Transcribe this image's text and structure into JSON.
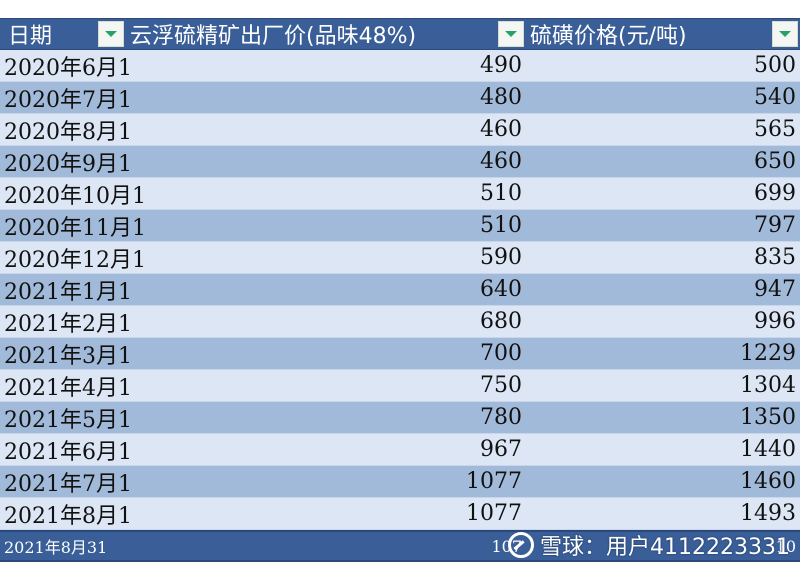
{
  "header": {
    "col1": "日期",
    "col2": "云浮硫精矿出厂价(品味48%)",
    "col3": "硫磺价格(元/吨)",
    "filter_icon": "dropdown-filter-icon"
  },
  "rows": [
    {
      "date": "2020年6月1",
      "pyrite": "490",
      "sulfur": "500"
    },
    {
      "date": "2020年7月1",
      "pyrite": "480",
      "sulfur": "540"
    },
    {
      "date": "2020年8月1",
      "pyrite": "460",
      "sulfur": "565"
    },
    {
      "date": "2020年9月1",
      "pyrite": "460",
      "sulfur": "650"
    },
    {
      "date": "2020年10月1",
      "pyrite": "510",
      "sulfur": "699"
    },
    {
      "date": "2020年11月1",
      "pyrite": "510",
      "sulfur": "797"
    },
    {
      "date": "2020年12月1",
      "pyrite": "590",
      "sulfur": "835"
    },
    {
      "date": "2021年1月1",
      "pyrite": "640",
      "sulfur": "947"
    },
    {
      "date": "2021年2月1",
      "pyrite": "680",
      "sulfur": "996"
    },
    {
      "date": "2021年3月1",
      "pyrite": "700",
      "sulfur": "1229"
    },
    {
      "date": "2021年4月1",
      "pyrite": "750",
      "sulfur": "1304"
    },
    {
      "date": "2021年5月1",
      "pyrite": "780",
      "sulfur": "1350"
    },
    {
      "date": "2021年6月1",
      "pyrite": "967",
      "sulfur": "1440"
    },
    {
      "date": "2021年7月1",
      "pyrite": "1077",
      "sulfur": "1460"
    },
    {
      "date": "2021年8月1",
      "pyrite": "1077",
      "sulfur": "1493"
    }
  ],
  "last_row": {
    "date": "2021年8月31",
    "pyrite": "107",
    "sulfur": "10"
  },
  "watermark": {
    "text": "雪球：用户4112223331"
  },
  "colors": {
    "header_bg": "#3a5f98",
    "row_light": "#dde6f5",
    "row_dark": "#a2bad9",
    "filter_arrow": "#23a36b"
  }
}
